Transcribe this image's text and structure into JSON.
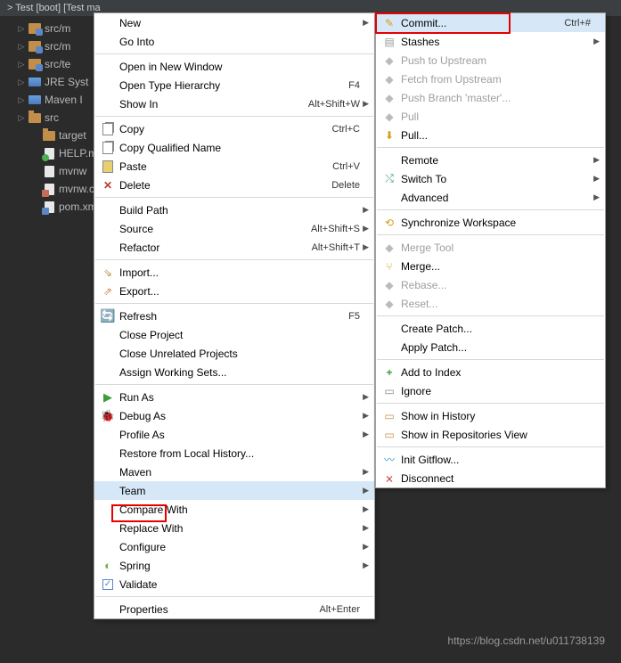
{
  "breadcrumb": "> Test [boot] [Test ma",
  "tree": [
    {
      "arrow": "▷",
      "indent": 1,
      "icon": "pkg",
      "label": "src/m"
    },
    {
      "arrow": "▷",
      "indent": 1,
      "icon": "pkg",
      "label": "src/m"
    },
    {
      "arrow": "▷",
      "indent": 1,
      "icon": "pkg",
      "label": "src/te"
    },
    {
      "arrow": "▷",
      "indent": 1,
      "icon": "lib",
      "label": "JRE Syst"
    },
    {
      "arrow": "▷",
      "indent": 1,
      "icon": "lib",
      "label": "Maven I"
    },
    {
      "arrow": "▷",
      "indent": 1,
      "icon": "folder-pkg",
      "label": "src"
    },
    {
      "arrow": "",
      "indent": 2,
      "icon": "folder",
      "label": "target"
    },
    {
      "arrow": "",
      "indent": 2,
      "icon": "file-green",
      "label": "HELP.m"
    },
    {
      "arrow": "",
      "indent": 2,
      "icon": "file",
      "label": "mvnw"
    },
    {
      "arrow": "",
      "indent": 2,
      "icon": "file-bat",
      "label": "mvnw.cn"
    },
    {
      "arrow": "",
      "indent": 2,
      "icon": "file-xml",
      "label": "pom.xm"
    }
  ],
  "menu1": [
    {
      "t": "item",
      "label": "New",
      "sub": true
    },
    {
      "t": "item",
      "label": "Go Into"
    },
    {
      "t": "sep"
    },
    {
      "t": "item",
      "label": "Open in New Window"
    },
    {
      "t": "item",
      "label": "Open Type Hierarchy",
      "short": "F4"
    },
    {
      "t": "item",
      "label": "Show In",
      "short": "Alt+Shift+W",
      "sub": true
    },
    {
      "t": "sep"
    },
    {
      "t": "item",
      "icon": "copy",
      "label": "Copy",
      "short": "Ctrl+C"
    },
    {
      "t": "item",
      "icon": "copy",
      "label": "Copy Qualified Name"
    },
    {
      "t": "item",
      "icon": "paste",
      "label": "Paste",
      "short": "Ctrl+V"
    },
    {
      "t": "item",
      "icon": "delete",
      "label": "Delete",
      "short": "Delete"
    },
    {
      "t": "sep"
    },
    {
      "t": "item",
      "label": "Build Path",
      "sub": true
    },
    {
      "t": "item",
      "label": "Source",
      "short": "Alt+Shift+S",
      "sub": true
    },
    {
      "t": "item",
      "label": "Refactor",
      "short": "Alt+Shift+T",
      "sub": true
    },
    {
      "t": "sep"
    },
    {
      "t": "item",
      "icon": "import",
      "label": "Import..."
    },
    {
      "t": "item",
      "icon": "export",
      "label": "Export..."
    },
    {
      "t": "sep"
    },
    {
      "t": "item",
      "icon": "refresh",
      "label": "Refresh",
      "short": "F5"
    },
    {
      "t": "item",
      "label": "Close Project"
    },
    {
      "t": "item",
      "label": "Close Unrelated Projects"
    },
    {
      "t": "item",
      "label": "Assign Working Sets..."
    },
    {
      "t": "sep"
    },
    {
      "t": "item",
      "icon": "run",
      "label": "Run As",
      "sub": true
    },
    {
      "t": "item",
      "icon": "debug",
      "label": "Debug As",
      "sub": true
    },
    {
      "t": "item",
      "label": "Profile As",
      "sub": true
    },
    {
      "t": "item",
      "label": "Restore from Local History..."
    },
    {
      "t": "item",
      "label": "Maven",
      "sub": true
    },
    {
      "t": "item",
      "label": "Team",
      "sub": true,
      "hover": true
    },
    {
      "t": "item",
      "label": "Compare With",
      "sub": true
    },
    {
      "t": "item",
      "label": "Replace With",
      "sub": true
    },
    {
      "t": "item",
      "label": "Configure",
      "sub": true
    },
    {
      "t": "item",
      "icon": "spring",
      "label": "Spring",
      "sub": true
    },
    {
      "t": "item",
      "icon": "check",
      "label": "Validate"
    },
    {
      "t": "sep"
    },
    {
      "t": "item",
      "label": "Properties",
      "short": "Alt+Enter"
    }
  ],
  "menu2": [
    {
      "t": "item",
      "icon": "commit",
      "label": "Commit...",
      "short": "Ctrl+#",
      "hover": true
    },
    {
      "t": "item",
      "icon": "stash",
      "label": "Stashes",
      "sub": true
    },
    {
      "t": "item",
      "icon": "gray",
      "label": "Push to Upstream",
      "disabled": true
    },
    {
      "t": "item",
      "icon": "gray",
      "label": "Fetch from Upstream",
      "disabled": true
    },
    {
      "t": "item",
      "icon": "gray",
      "label": "Push Branch 'master'...",
      "disabled": true
    },
    {
      "t": "item",
      "icon": "gray",
      "label": "Pull",
      "disabled": true
    },
    {
      "t": "item",
      "icon": "pull",
      "label": "Pull..."
    },
    {
      "t": "sep"
    },
    {
      "t": "item",
      "label": "Remote",
      "sub": true
    },
    {
      "t": "item",
      "icon": "switch",
      "label": "Switch To",
      "sub": true
    },
    {
      "t": "item",
      "label": "Advanced",
      "sub": true
    },
    {
      "t": "sep"
    },
    {
      "t": "item",
      "icon": "sync",
      "label": "Synchronize Workspace"
    },
    {
      "t": "sep"
    },
    {
      "t": "item",
      "icon": "gray",
      "label": "Merge Tool",
      "disabled": true
    },
    {
      "t": "item",
      "icon": "merge",
      "label": "Merge..."
    },
    {
      "t": "item",
      "icon": "gray",
      "label": "Rebase...",
      "disabled": true
    },
    {
      "t": "item",
      "icon": "gray",
      "label": "Reset...",
      "disabled": true
    },
    {
      "t": "sep"
    },
    {
      "t": "item",
      "label": "Create Patch..."
    },
    {
      "t": "item",
      "label": "Apply Patch..."
    },
    {
      "t": "sep"
    },
    {
      "t": "item",
      "icon": "add",
      "label": "Add to Index"
    },
    {
      "t": "item",
      "icon": "ignore",
      "label": "Ignore"
    },
    {
      "t": "sep"
    },
    {
      "t": "item",
      "icon": "hist",
      "label": "Show in History"
    },
    {
      "t": "item",
      "icon": "repo",
      "label": "Show in Repositories View"
    },
    {
      "t": "sep"
    },
    {
      "t": "item",
      "icon": "flow",
      "label": "Init Gitflow..."
    },
    {
      "t": "item",
      "icon": "disc",
      "label": "Disconnect"
    }
  ],
  "watermark": "https://blog.csdn.net/u011738139"
}
